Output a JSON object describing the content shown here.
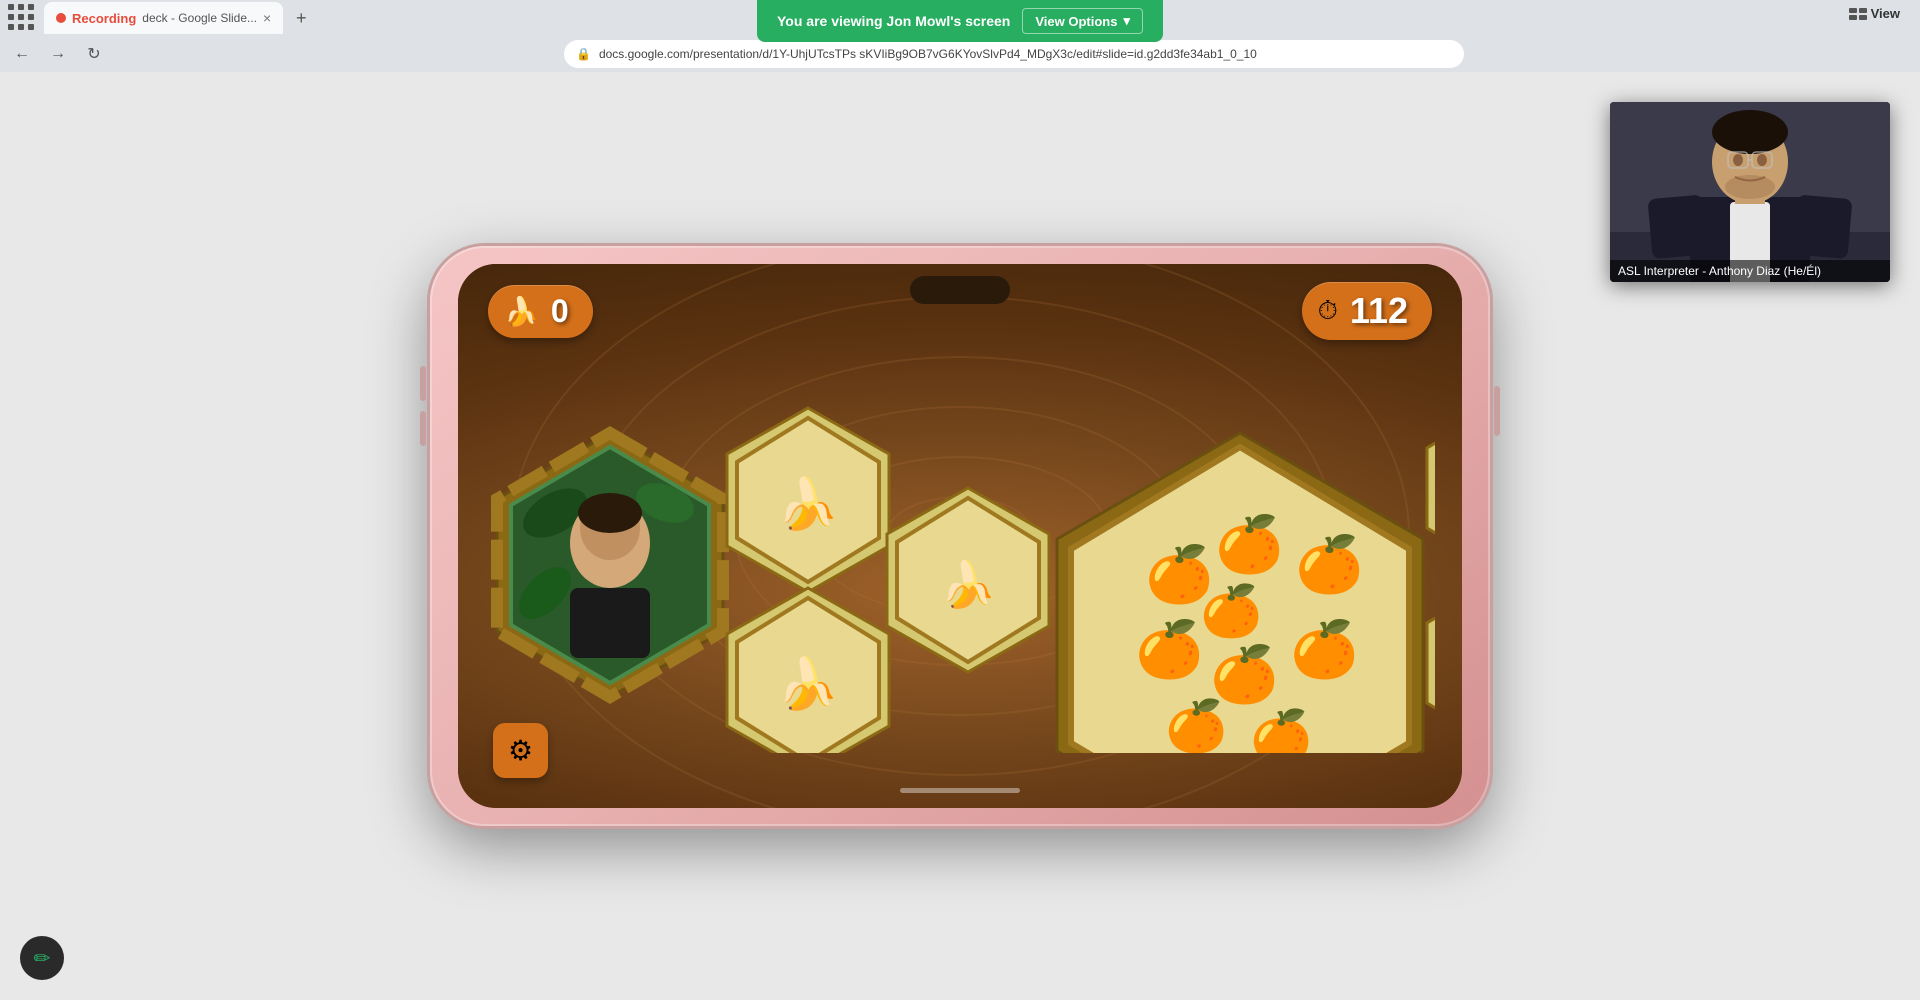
{
  "browser": {
    "tab": {
      "recording_dot": "●",
      "recording_label": "Recording",
      "title": "deck - Google Slide...",
      "close": "×",
      "new_tab": "+"
    },
    "address": "docs.google.com/presentation/d/1Y-UhjUTcsTPs sKVIiBg9OB7vG6KYovSlvPd4_MDgX3c/edit#slide=id.g2dd3fe34ab1_0_10",
    "nav": {
      "back": "←",
      "forward": "→",
      "reload": "↻"
    },
    "view_label": "View"
  },
  "screen_share_banner": {
    "message": "You are viewing Jon Mowl's screen",
    "button_label": "View Options",
    "chevron": "▾"
  },
  "game": {
    "score_label": "0",
    "timer_label": "112",
    "banana_emoji": "🍌",
    "timer_emoji": "⏱",
    "orange_emoji": "🍊",
    "settings_emoji": "⚙",
    "score_icon": "banana",
    "timer_icon": "stopwatch"
  },
  "video_overlay": {
    "label": "ASL Interpreter - Anthony Diaz (He/Él)"
  },
  "pencil_btn": {
    "icon": "✏"
  }
}
